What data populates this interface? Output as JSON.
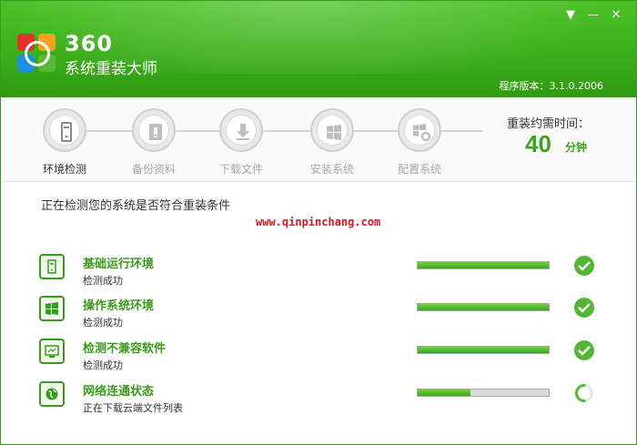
{
  "app": {
    "brand_number": "360",
    "brand_name": "系统重装大师",
    "version": "程序版本：3.1.0.2006",
    "controls": {
      "menu": "▼",
      "minimize": "—",
      "close": "✕"
    }
  },
  "steps": [
    {
      "label": "环境检测",
      "active": true,
      "icon": "computer-icon"
    },
    {
      "label": "备份资料",
      "active": false,
      "icon": "backup-icon"
    },
    {
      "label": "下载文件",
      "active": false,
      "icon": "download-icon"
    },
    {
      "label": "安装系统",
      "active": false,
      "icon": "windows-icon"
    },
    {
      "label": "配置系统",
      "active": false,
      "icon": "settings-icon"
    }
  ],
  "time": {
    "title": "重装约需时间：",
    "value": "40",
    "unit": "分钟"
  },
  "main": {
    "title": "正在检测您的系统是否符合重装条件",
    "watermark": "www.qinpinchang.com"
  },
  "checks": [
    {
      "title": "基础运行环境",
      "status": "检测成功",
      "progress": 1.0,
      "state": "done",
      "icon": "computer-icon"
    },
    {
      "title": "操作系统环境",
      "status": "检测成功",
      "progress": 1.0,
      "state": "done",
      "icon": "windows-icon"
    },
    {
      "title": "检测不兼容软件",
      "status": "检测成功",
      "progress": 1.0,
      "state": "done",
      "icon": "monitor-icon"
    },
    {
      "title": "网络连通状态",
      "status": "正在下载云端文件列表",
      "progress": 0.4,
      "state": "loading",
      "icon": "globe-icon"
    }
  ],
  "colors": {
    "accent": "#3a9a1c",
    "header": "#3cae1b",
    "watermark": "#e0141f"
  }
}
